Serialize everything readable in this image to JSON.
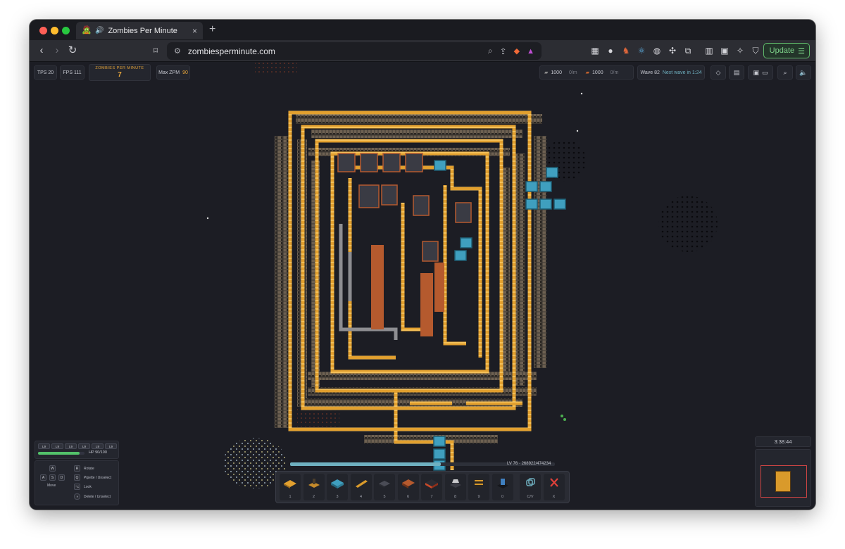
{
  "browser": {
    "tab_title": "Zombies Per Minute",
    "url": "zombiesperminute.com",
    "update_label": "Update",
    "extension_badge": "3"
  },
  "hud": {
    "tps": "TPS 20",
    "fps": "FPS 111",
    "zpm_label": "ZOMBIES PER MINUTE",
    "zpm_value": "7",
    "max_zpm_label": "Max ZPM",
    "max_zpm_value": "90",
    "resource1_amount": "1000",
    "resource1_rate": "0/m",
    "resource2_amount": "1000",
    "resource2_rate": "0/m",
    "wave_label": "Wave 82",
    "next_wave": "Next wave in 1:24"
  },
  "player": {
    "levels": [
      "L9",
      "L9",
      "L9",
      "L9",
      "L9",
      "L9"
    ],
    "hp_text": "HP 90/100",
    "hp_fraction": 0.9
  },
  "controls": {
    "keys": [
      "W",
      "A",
      "S",
      "D",
      "R",
      "Q"
    ],
    "move_label": "Move",
    "rotate": "Rotate",
    "pipette": "Pipette / Unselect",
    "look": "Look",
    "delete": "Delete / Unselect"
  },
  "progress": {
    "level_text": "LV 76 · 268922/474234",
    "fraction": 0.57
  },
  "hotbar": [
    {
      "num": "1",
      "icon": "conveyor-tile-icon"
    },
    {
      "num": "2",
      "icon": "inserter-icon"
    },
    {
      "num": "3",
      "icon": "water-tank-icon"
    },
    {
      "num": "4",
      "icon": "plank-icon"
    },
    {
      "num": "5",
      "icon": "dark-block-icon"
    },
    {
      "num": "6",
      "icon": "red-machine-icon"
    },
    {
      "num": "7",
      "icon": "furnace-icon"
    },
    {
      "num": "8",
      "icon": "drill-icon"
    },
    {
      "num": "9",
      "icon": "barrel-icon"
    },
    {
      "num": "0",
      "icon": "turret-icon"
    },
    {
      "num": "C/V",
      "icon": "copy-icon"
    },
    {
      "num": "X",
      "icon": "close-icon"
    }
  ],
  "timer": "3:38:44",
  "colors": {
    "belt": "#e2a02f",
    "wall": "#6e6152",
    "machine_blue": "#3f9fbf",
    "machine_red": "#b55a2e",
    "background": "#1c1d24"
  }
}
